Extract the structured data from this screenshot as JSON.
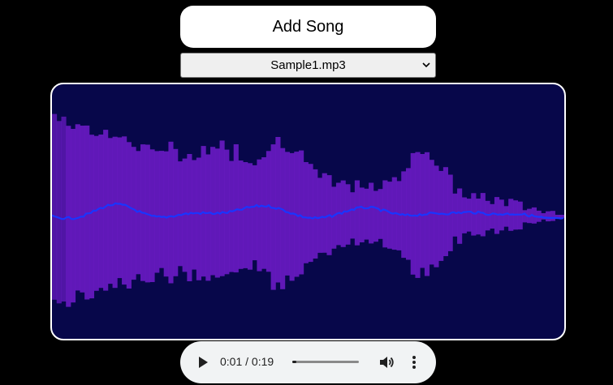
{
  "add_song": {
    "label": "Add Song"
  },
  "song_select": {
    "selected": "Sample1.mp3"
  },
  "player": {
    "current_time": "0:01",
    "separator": " / ",
    "duration": "0:19",
    "progress": 0.06
  },
  "colors": {
    "background": "#000000",
    "visualizer_bg": "#07074a",
    "bars": "#6a1bc4",
    "wave": "#1a35ff"
  }
}
